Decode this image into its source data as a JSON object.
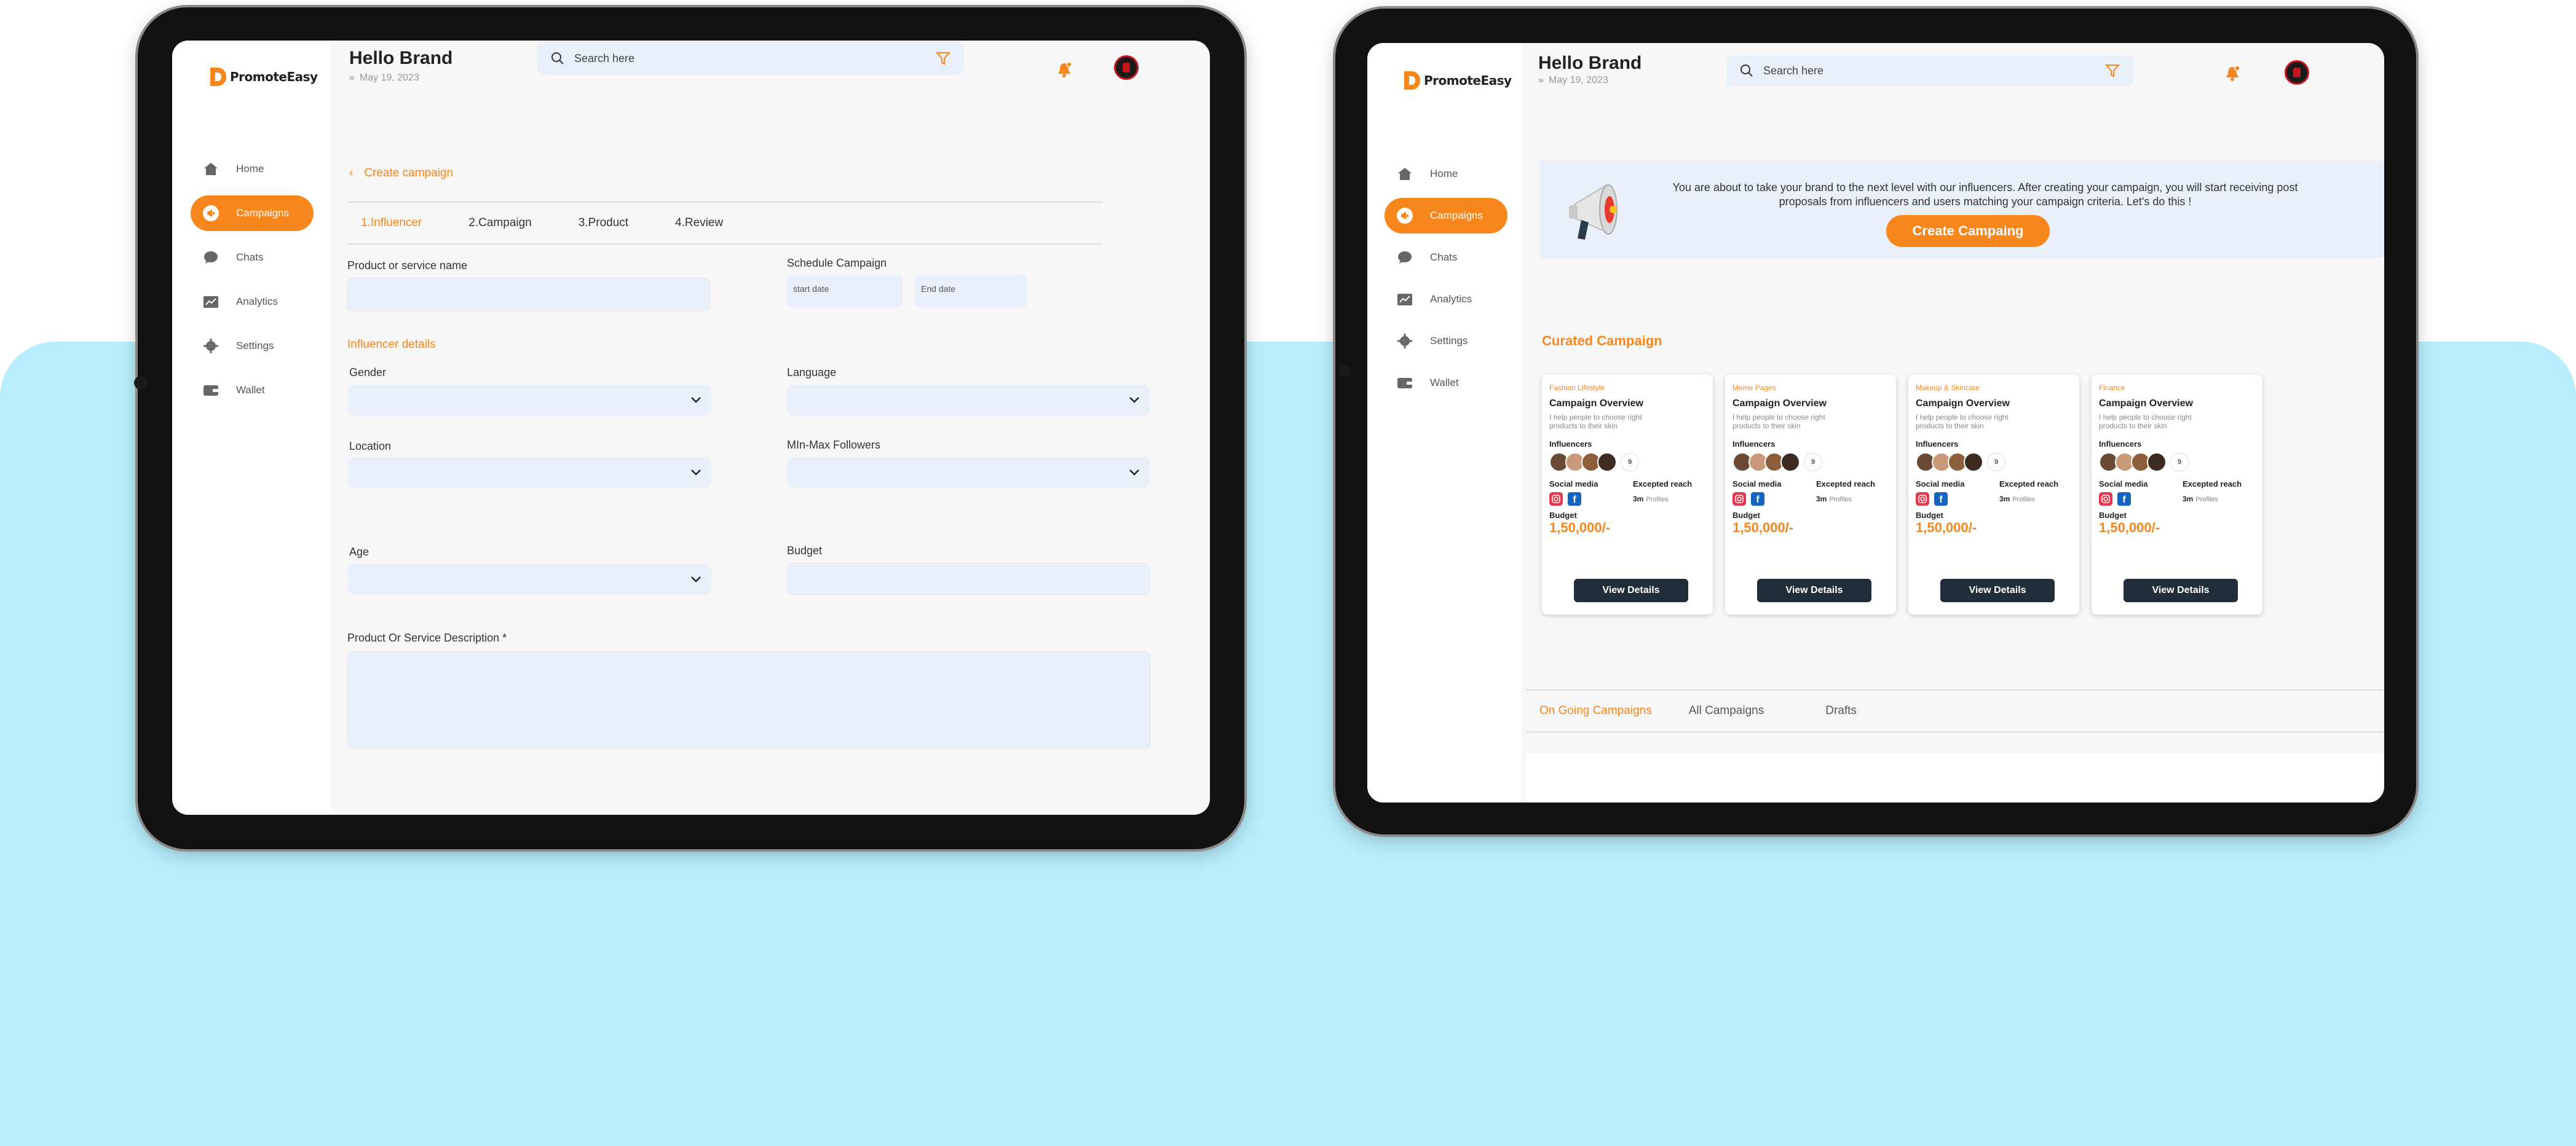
{
  "brand": {
    "name": "PromoteEasy",
    "accent": "#f7861c"
  },
  "left": {
    "header": {
      "greeting": "Hello Brand",
      "date": "May 19, 2023",
      "search_placeholder": "Search here"
    },
    "nav": [
      {
        "label": "Home",
        "icon": "home-icon",
        "active": false
      },
      {
        "label": "Campaigns",
        "icon": "megaphone-icon",
        "active": true
      },
      {
        "label": "Chats",
        "icon": "chat-icon",
        "active": false
      },
      {
        "label": "Analytics",
        "icon": "analytics-icon",
        "active": false
      },
      {
        "label": "Settings",
        "icon": "gear-icon",
        "active": false
      },
      {
        "label": "Wallet",
        "icon": "wallet-icon",
        "active": false
      }
    ],
    "back_label": "Create campaign",
    "steps": [
      "1.Influencer",
      "2.Campaign",
      "3.Product",
      "4.Review"
    ],
    "form": {
      "product_name_label": "Product or service name",
      "schedule_label": "Schedule Campaign",
      "start_date_placeholder": "start date",
      "end_date_placeholder": "End date",
      "influencer_details_label": "Influencer details",
      "gender_label": "Gender",
      "language_label": "Language",
      "location_label": "Location",
      "followers_label": "MIn-Max Followers",
      "age_label": "Age",
      "budget_label": "Budget",
      "description_label": "Product Or Service Description *"
    }
  },
  "right": {
    "header": {
      "greeting": "Hello Brand",
      "date": "May 19, 2023",
      "search_placeholder": "Search here"
    },
    "nav": [
      {
        "label": "Home",
        "icon": "home-icon",
        "active": false
      },
      {
        "label": "Campaigns",
        "icon": "megaphone-icon",
        "active": true
      },
      {
        "label": "Chats",
        "icon": "chat-icon",
        "active": false
      },
      {
        "label": "Analytics",
        "icon": "analytics-icon",
        "active": false
      },
      {
        "label": "Settings",
        "icon": "gear-icon",
        "active": false
      },
      {
        "label": "Wallet",
        "icon": "wallet-icon",
        "active": false
      }
    ],
    "banner_text": "You are about to take your brand to the next level with our influencers. After creating your campaign, you will start receiving post proposals from influencers and users matching your campaign criteria. Let's do this !",
    "cta_label": "Create Campaing",
    "curated_title": "Curated Campaign",
    "cards": [
      {
        "category": "Fashion Lifestyle",
        "title": "Campaign Overview",
        "desc": "I help people to choose right products to their skin",
        "influencers_label": "Influencers",
        "influencer_count": "9",
        "social_label": "Social  media",
        "reach_label": "Excepted reach",
        "reach_value": "3m",
        "reach_unit": "Profiles",
        "budget_label": "Budget",
        "budget": "1,50,000/-",
        "button": "View Details"
      },
      {
        "category": "Meme Pages",
        "title": "Campaign Overview",
        "desc": "I help people to choose right products to their skin",
        "influencers_label": "Influencers",
        "influencer_count": "9",
        "social_label": "Social  media",
        "reach_label": "Excepted reach",
        "reach_value": "3m",
        "reach_unit": "Profiles",
        "budget_label": "Budget",
        "budget": "1,50,000/-",
        "button": "View Details"
      },
      {
        "category": "Makeup & Skincare",
        "title": "Campaign Overview",
        "desc": "I help people to choose right products to their skin",
        "influencers_label": "Influencers",
        "influencer_count": "9",
        "social_label": "Social  media",
        "reach_label": "Excepted reach",
        "reach_value": "3m",
        "reach_unit": "Profiles",
        "budget_label": "Budget",
        "budget": "1,50,000/-",
        "button": "View Details"
      },
      {
        "category": "Finance",
        "title": "Campaign Overview",
        "desc": "I help people to choose right products to their skin",
        "influencers_label": "Influencers",
        "influencer_count": "9",
        "social_label": "Social  media",
        "reach_label": "Excepted reach",
        "reach_value": "3m",
        "reach_unit": "Profiles",
        "budget_label": "Budget",
        "budget": "1,50,000/-",
        "button": "View Details"
      }
    ],
    "tabs": [
      "On Going Campaigns",
      "All Campaigns",
      "Drafts"
    ]
  },
  "colors": {
    "accent": "#f7861c",
    "input_bg": "#e9f0fa",
    "background_band": "#b8eefc",
    "dark_button": "#222d3a"
  }
}
